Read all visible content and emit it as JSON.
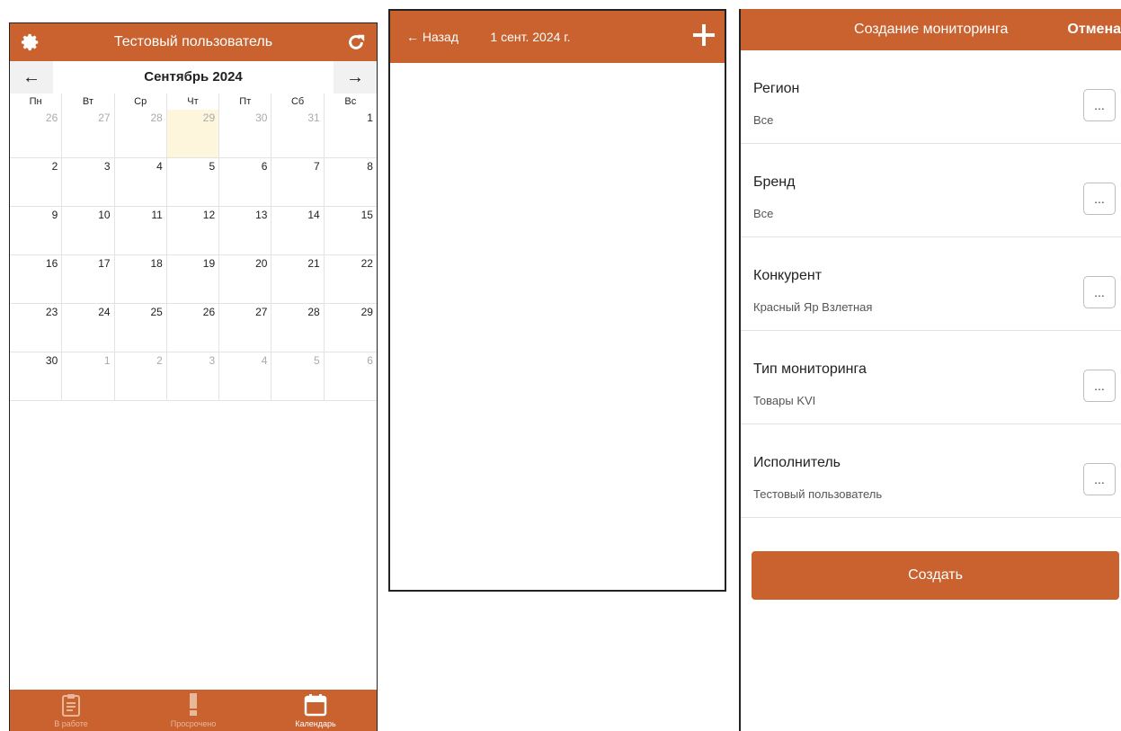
{
  "calendar_screen": {
    "header_title": "Тестовый пользователь",
    "month_label": "Сентябрь 2024",
    "prev_arrow": "←",
    "next_arrow": "→",
    "weekdays": [
      "Пн",
      "Вт",
      "Ср",
      "Чт",
      "Пт",
      "Сб",
      "Вс"
    ],
    "days": [
      "26",
      "27",
      "28",
      "29",
      "30",
      "31",
      "1",
      "2",
      "3",
      "4",
      "5",
      "6",
      "7",
      "8",
      "9",
      "10",
      "11",
      "12",
      "13",
      "14",
      "15",
      "16",
      "17",
      "18",
      "19",
      "20",
      "21",
      "22",
      "23",
      "24",
      "25",
      "26",
      "27",
      "28",
      "29",
      "30",
      "1",
      "2",
      "3",
      "4",
      "5",
      "6"
    ],
    "tabs": [
      {
        "label": "В работе",
        "icon": "clipboard-icon"
      },
      {
        "label": "Просрочено",
        "icon": "exclamation-icon"
      },
      {
        "label": "Календарь",
        "icon": "calendar-icon"
      }
    ]
  },
  "day_screen": {
    "back_label": "← Назад",
    "title": "1 сент. 2024 г."
  },
  "create_screen": {
    "title": "Создание мониторинга",
    "cancel_label": "Отмена",
    "fields": [
      {
        "label": "Регион",
        "value": "Все"
      },
      {
        "label": "Бренд",
        "value": "Все"
      },
      {
        "label": "Конкурент",
        "value": "Красный Яр Взлетная"
      },
      {
        "label": "Тип мониторинга",
        "value": "Товары KVI"
      },
      {
        "label": "Исполнитель",
        "value": "Тестовый пользователь"
      }
    ],
    "dots_label": "...",
    "create_label": "Создать"
  },
  "colors": {
    "accent": "#c9622f",
    "today_highlight": "#fdf6dc"
  }
}
